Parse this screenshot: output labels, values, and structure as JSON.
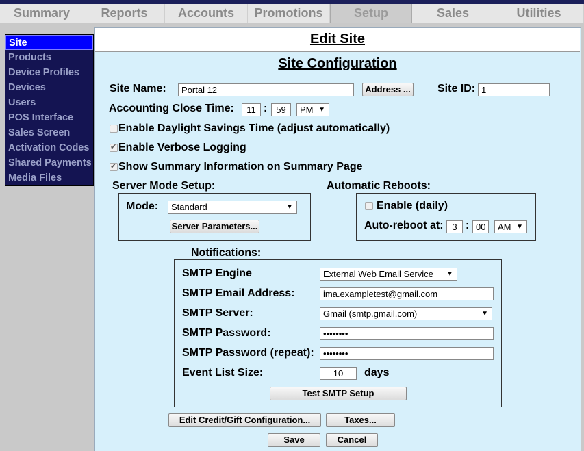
{
  "nav": {
    "tabs": [
      "Summary",
      "Reports",
      "Accounts",
      "Promotions",
      "Setup",
      "Sales",
      "Utilities"
    ],
    "active": "Setup"
  },
  "sidebar": {
    "items": [
      "Site",
      "Products",
      "Device Profiles",
      "Devices",
      "Users",
      "POS Interface",
      "Sales Screen",
      "Activation Codes",
      "Shared Payments",
      "Media Files"
    ],
    "active": "Site"
  },
  "page": {
    "title": "Edit Site",
    "section_title": "Site Configuration"
  },
  "site": {
    "name_label": "Site Name:",
    "name_value": "Portal 12",
    "address_button": "Address ...",
    "id_label": "Site ID:",
    "id_value": "1",
    "close_time_label": "Accounting Close Time:",
    "close_hour": "11",
    "close_minute": "59",
    "close_ampm": "PM",
    "dst_label": "Enable Daylight Savings Time (adjust automatically)",
    "dst_checked": false,
    "verbose_label": "Enable Verbose Logging",
    "verbose_checked": true,
    "summary_label": "Show Summary Information on Summary Page",
    "summary_checked": true
  },
  "server_mode": {
    "heading": "Server Mode Setup:",
    "mode_label": "Mode:",
    "mode_value": "Standard",
    "params_button": "Server Parameters..."
  },
  "reboots": {
    "heading": "Automatic Reboots:",
    "enable_label": "Enable (daily)",
    "enable_checked": false,
    "at_label": "Auto-reboot at:",
    "hour": "3",
    "minute": "00",
    "ampm": "AM"
  },
  "notifications": {
    "heading": "Notifications:",
    "engine_label": "SMTP Engine",
    "engine_value": "External Web Email Service",
    "email_label": "SMTP Email Address:",
    "email_value": "ima.exampletest@gmail.com",
    "server_label": "SMTP Server:",
    "server_value": "Gmail (smtp.gmail.com)",
    "password_label": "SMTP Password:",
    "password_value": "••••••••",
    "password_repeat_label": "SMTP Password (repeat):",
    "password_repeat_value": "••••••••",
    "event_size_label": "Event List Size:",
    "event_size_value": "10",
    "event_size_unit": "days",
    "test_button": "Test SMTP Setup"
  },
  "actions": {
    "credit_gift_button": "Edit Credit/Gift Configuration...",
    "taxes_button": "Taxes...",
    "save_button": "Save",
    "cancel_button": "Cancel"
  },
  "colon": ":"
}
